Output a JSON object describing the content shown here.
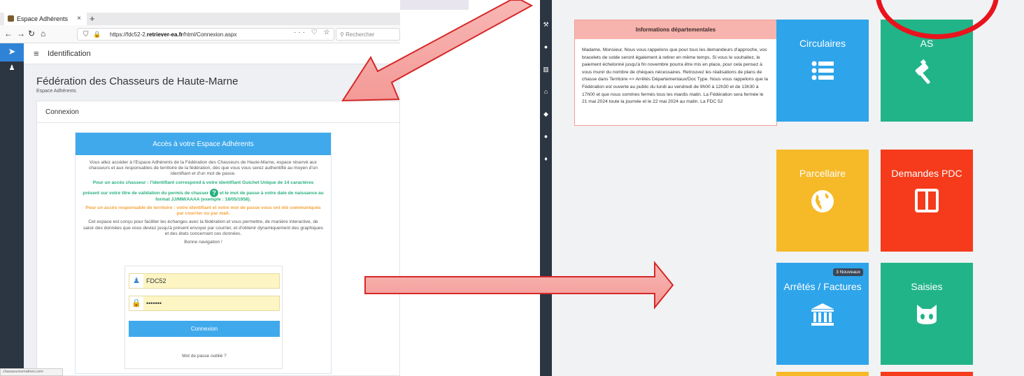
{
  "browser": {
    "tab_title": "Espace Adhérents",
    "tab_close": "×",
    "new_tab": "+",
    "url_prefix": "https://fdc52-2.",
    "url_domain": "retriever-ea.fr",
    "url_path": "/html/Connexion.aspx",
    "url_actions": "··· ♡ ☆",
    "search_placeholder": "Rechercher",
    "status_url": "chasseuresmatnev.com"
  },
  "app": {
    "header_title": "Identification",
    "org_name": "Fédération des Chasseurs de Haute-Marne",
    "org_subtitle": "Espace Adhérents",
    "card_title": "Connexion",
    "panel_title": "Accès à votre Espace Adhérents",
    "intro": "Vous allez accéder à l'Espace Adhérents de la Fédération des Chasseurs de Haute-Marne, espace réservé aux chasseurs et aux responsables de territoire de la fédération, dès que vous vous serez authentifié au moyen d'un identifiant et d'un mot de passe.",
    "hunter_line_1": "Pour un accès chasseur : l'identifiant correspond à votre identifiant Guichet Unique de 14 caractères",
    "hunter_line_2a": "présent sur votre titre de validation du permis de chasser",
    "hunter_line_2b": "et le mot de passe à votre date de naissance au format JJ/MM/AAAA (exemple : 18/05/1958).",
    "territory_line": "Pour un accès responsable de territoire : votre identifiant et votre mot de passe vous ont été communiqués par courrier ou par mail.",
    "purpose": "Cet espace est conçu pour faciliter les échanges avec la fédération et vous permettre, de manière interactive, de saisir des données que vous deviez jusqu'à présent envoyer par courrier, et d'obtenir dynamiquement des graphiques et des états concernant ces données.",
    "greeting": "Bonne navigation !",
    "username_value": "FDC52",
    "password_value": "•••••••",
    "login_button": "Connexion",
    "forgot_link": "Mot de passe oublié ?"
  },
  "dashboard": {
    "info_title": "Informations départementales",
    "info_text": "Madame, Monsieur, Nous vous rappelons que pour tous les demandeurs d'approche, vos bracelets de solde seront également à retirer en même temps. Si vous le souhaitez, le paiement échelonné jusqu'à fin novembre pourra être mis en place, pour cela pensez à vous munir du nombre de chèques nécessaires. Retrouvez les réalisations de plans de chasse dans Territoire => Arrêtés Départementaux/Doc Type. Nous vous rappelons que la Fédération est ouverte au public du lundi au vendredi de 9h00 à 12h30 et de 13h30 à 17h00 et que nous sommes fermés tous les mardis matin. La Fédération sera fermée le 21 mai 2024 toute la journée et le 22 mai 2024 au matin. La FDC 52",
    "tiles": {
      "circulaires": "Circulaires",
      "as": "AS",
      "parcellaire": "Parcellaire",
      "demandes": "Demandes PDC",
      "arretes": "Arrêtés / Factures",
      "arretes_badge": "3 Nouveaux",
      "saisies": "Saisies"
    },
    "colors": {
      "blue": "#2ea4ea",
      "green": "#22b489",
      "yellow": "#f6b928",
      "red": "#f53b1b",
      "annotation": "#e8141d"
    }
  }
}
